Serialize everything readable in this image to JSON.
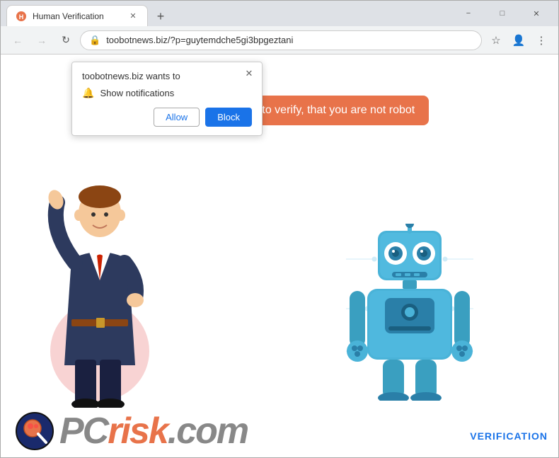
{
  "window": {
    "title": "Human Verification",
    "tab_label": "Human Verification",
    "url": "toobotnews.biz/?p=guytemdche5gi3bpgeztani",
    "url_protocol": "🔒"
  },
  "controls": {
    "back": "←",
    "forward": "→",
    "refresh": "↻",
    "minimize": "−",
    "maximize": "□",
    "close": "✕",
    "new_tab": "+",
    "tab_close": "✕",
    "star": "☆",
    "profile": "👤",
    "menu": "⋮",
    "popup_close": "✕"
  },
  "notification_popup": {
    "title": "toobotnews.biz wants to",
    "permission": "Show notifications",
    "allow_label": "Allow",
    "block_label": "Block"
  },
  "speech_bubble": {
    "text": "Press \"Allow\" to verify, that you are not robot"
  },
  "footer": {
    "verification_label": "VERIFICATION",
    "logo_pc": "PC",
    "logo_risk": "risk",
    "logo_com": ".com"
  },
  "colors": {
    "accent_orange": "#e8734a",
    "accent_blue": "#1a73e8",
    "robot_blue": "#4ab3d8",
    "robot_dark": "#2a7fa8"
  }
}
